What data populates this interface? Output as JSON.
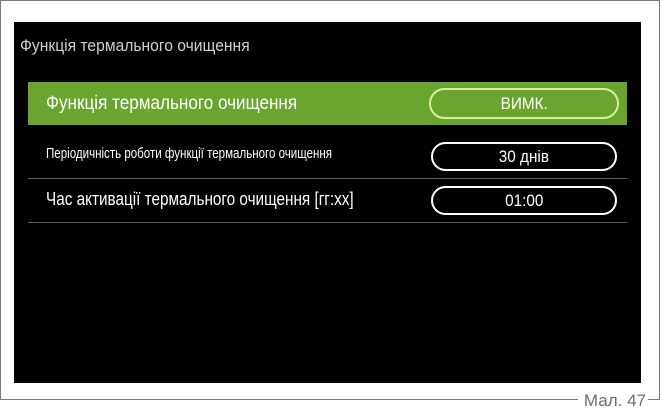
{
  "screen": {
    "title": "Функція термального очищення",
    "rows": [
      {
        "label": "Функція термального очищення",
        "value": "ВИМК.",
        "selected": true
      },
      {
        "label": "Періодичність роботи функції термального очищення",
        "value": "30 днів",
        "selected": false
      },
      {
        "label": "Час активації термального очищення [гг:хх]",
        "value": "01:00",
        "selected": false
      }
    ]
  },
  "figure_caption": "Мал. 47",
  "colors": {
    "selection": "#6aa52f",
    "screen_background": "#000000",
    "text": "#ffffff"
  }
}
